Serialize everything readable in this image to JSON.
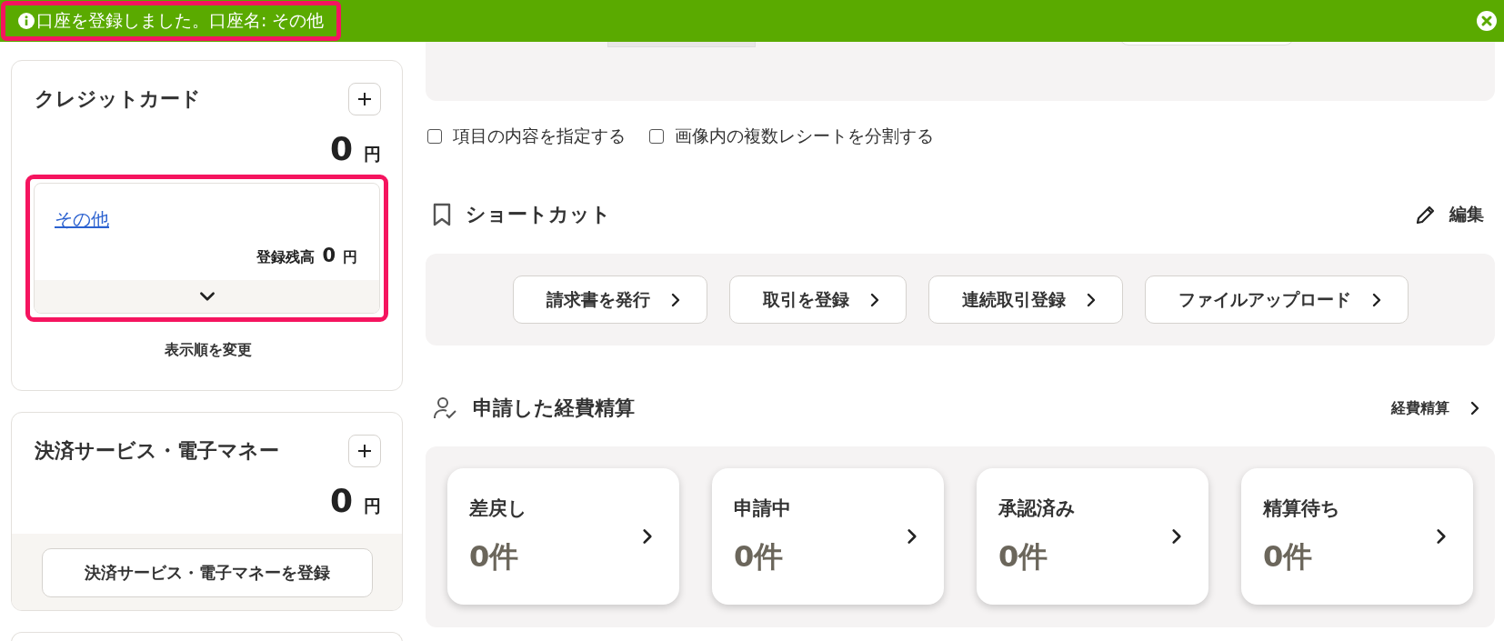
{
  "toast": {
    "message": "口座を登録しました。口座名: その他",
    "highlighted": true
  },
  "left": [
    {
      "kind": "accounts",
      "title": "クレジットカード",
      "total": "0",
      "unit": "円",
      "accounts": [
        {
          "name": "その他",
          "balance_label": "登録残高",
          "balance": "0",
          "unit": "円",
          "highlighted": true
        }
      ],
      "reorder": "表示順を変更"
    },
    {
      "kind": "register",
      "title": "決済サービス・電子マネー",
      "total": "0",
      "unit": "円",
      "button": "決済サービス・電子マネーを登録"
    }
  ],
  "options": [
    {
      "label": "項目の内容を指定する",
      "checked": false
    },
    {
      "label": "画像内の複数レシートを分割する",
      "checked": false
    }
  ],
  "shortcuts": {
    "title": "ショートカット",
    "edit": "編集",
    "buttons": [
      "請求書を発行",
      "取引を登録",
      "連続取引登録",
      "ファイルアップロード"
    ]
  },
  "expenses": {
    "title": "申請した経費精算",
    "link": "経費精算",
    "cards": [
      {
        "label": "差戻し",
        "count": "0件"
      },
      {
        "label": "申請中",
        "count": "0件"
      },
      {
        "label": "承認済み",
        "count": "0件"
      },
      {
        "label": "精算待ち",
        "count": "0件"
      }
    ]
  }
}
